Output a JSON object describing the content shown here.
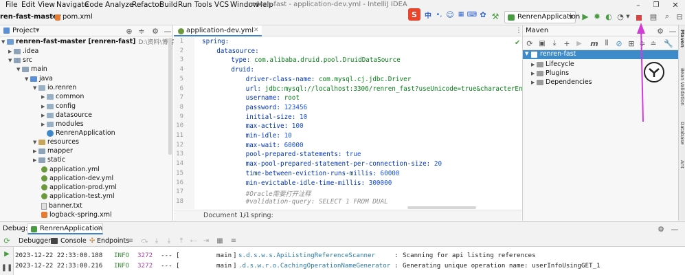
{
  "menu": {
    "title_frag": "renren-fast-master",
    "items": [
      "File",
      "Edit",
      "View",
      "Navigate",
      "Code",
      "Analyze",
      "Refactor",
      "Build",
      "Run",
      "Tools",
      "VCS",
      "Window",
      "Help"
    ],
    "window_title": "renren-fast - application-dev.yml - IntelliJ IDEA"
  },
  "breadcrumb": {
    "project": "ren-fast-master",
    "file": "pom.xml"
  },
  "toolbar": {
    "run_config": "RenrenApplication"
  },
  "project": {
    "title": "Project",
    "root": "renren-fast-master [renren-fast]",
    "root_path": "D:\\资料\\博客文件\\系统源码",
    "items": [
      {
        "label": ".idea"
      },
      {
        "label": "src"
      },
      {
        "label": "main"
      },
      {
        "label": "java"
      },
      {
        "label": "io.renren"
      },
      {
        "label": "common"
      },
      {
        "label": "config"
      },
      {
        "label": "datasource"
      },
      {
        "label": "modules"
      },
      {
        "label": "RenrenApplication"
      },
      {
        "label": "resources"
      },
      {
        "label": "mapper"
      },
      {
        "label": "static"
      },
      {
        "label": "application.yml"
      },
      {
        "label": "application-dev.yml"
      },
      {
        "label": "application-prod.yml"
      },
      {
        "label": "application-test.yml"
      },
      {
        "label": "banner.txt"
      },
      {
        "label": "logback-spring.xml"
      }
    ]
  },
  "editor": {
    "tab": "application-dev.yml",
    "line_numbers": [
      "1",
      "2",
      "3",
      "4",
      "5",
      "6",
      "7",
      "8",
      "9",
      "10",
      "11",
      "12",
      "13",
      "14",
      "15",
      "16",
      "17",
      "18"
    ],
    "lines": [
      {
        "key": "spring:",
        "val": ""
      },
      {
        "key": "datasource:",
        "val": ""
      },
      {
        "key": "type: ",
        "val": "com.alibaba.druid.pool.DruidDataSource"
      },
      {
        "key": "druid:",
        "val": ""
      },
      {
        "key": "driver-class-name: ",
        "val": "com.mysql.cj.jdbc.Driver"
      },
      {
        "key": "url: ",
        "val": "jdbc:mysql://localhost:3306/renren_fast?useUnicode=true&characterEncodi"
      },
      {
        "key": "username: ",
        "val": "root"
      },
      {
        "key": "password: ",
        "val": "123456"
      },
      {
        "key": "initial-size: ",
        "val": "10"
      },
      {
        "key": "max-active: ",
        "val": "100"
      },
      {
        "key": "min-idle: ",
        "val": "10"
      },
      {
        "key": "max-wait: ",
        "val": "60000"
      },
      {
        "key": "pool-prepared-statements: ",
        "val": "true"
      },
      {
        "key": "max-pool-prepared-statement-per-connection-size: ",
        "val": "20"
      },
      {
        "key": "time-between-eviction-runs-millis: ",
        "val": "60000"
      },
      {
        "key": "min-evictable-idle-time-millis: ",
        "val": "300000"
      },
      {
        "key": "#Oracle需要打开注释",
        "val": ""
      },
      {
        "key": "#validation-query: SELECT 1 FROM DUAL",
        "val": ""
      }
    ],
    "status_doc": "Document 1/1",
    "status_path": "spring:"
  },
  "maven": {
    "title": "Maven",
    "project": "renren-fast",
    "items": [
      "Lifecycle",
      "Plugins",
      "Dependencies"
    ]
  },
  "side_tabs": [
    "Maven",
    "Bean Validation",
    "Database",
    "Ant"
  ],
  "debug": {
    "label": "Debug:",
    "config": "RenrenApplication",
    "tabs": [
      "Debugger",
      "Console",
      "Endpoints"
    ],
    "logs": [
      {
        "date": "2023-12-22 22:33:00.188",
        "level": "INFO",
        "pid": "3272",
        "thread": "main",
        "logger": "s.d.s.w.s.ApiListingReferenceScanner",
        "msg": "Scanning for api listing references"
      },
      {
        "date": "2023-12-22 22:33:00.216",
        "level": "INFO",
        "pid": "3272",
        "thread": "main",
        "logger": ".d.s.w.r.o.CachingOperationNameGenerator",
        "msg": "Generating unique operation name: userInfoUsingGET_1"
      }
    ]
  },
  "colors": {
    "accent": "#3d8cc9",
    "stop": "#d64545",
    "annotation": "#d13cd6"
  }
}
